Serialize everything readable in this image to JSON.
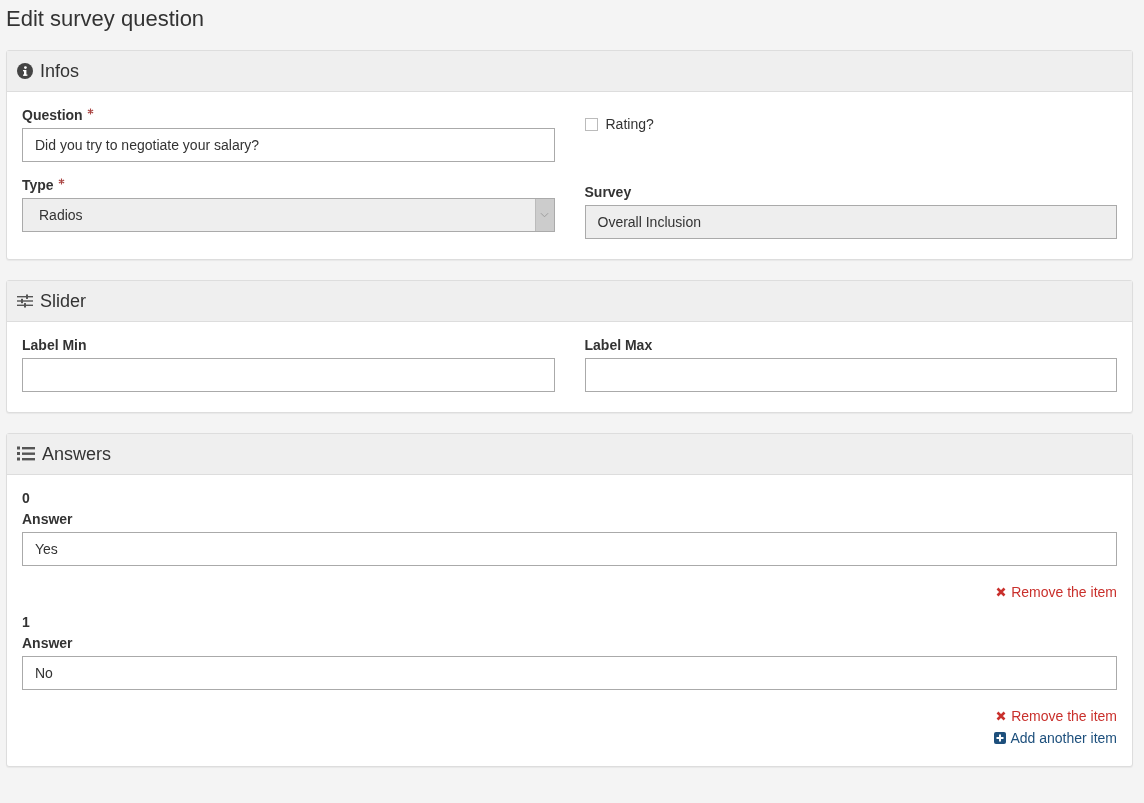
{
  "page_title": "Edit survey question",
  "infos": {
    "title": "Infos",
    "question": {
      "label": "Question",
      "required": true,
      "value": "Did you try to negotiate your salary?"
    },
    "rating": {
      "label": "Rating?",
      "checked": false
    },
    "type": {
      "label": "Type",
      "required": true,
      "value": "Radios",
      "disabled": true
    },
    "survey": {
      "label": "Survey",
      "value": "Overall Inclusion",
      "disabled": true
    }
  },
  "slider": {
    "title": "Slider",
    "fields": [
      {
        "label": "Label Min"
      },
      {
        "label": "Label Max"
      }
    ]
  },
  "answers": {
    "title": "Answers",
    "items": [
      {
        "index": "0",
        "label": "Answer",
        "value": "Yes",
        "remove": "Remove the item"
      },
      {
        "index": "1",
        "label": "Answer",
        "value": "No",
        "remove": "Remove the item"
      }
    ],
    "add": "Add another item"
  }
}
